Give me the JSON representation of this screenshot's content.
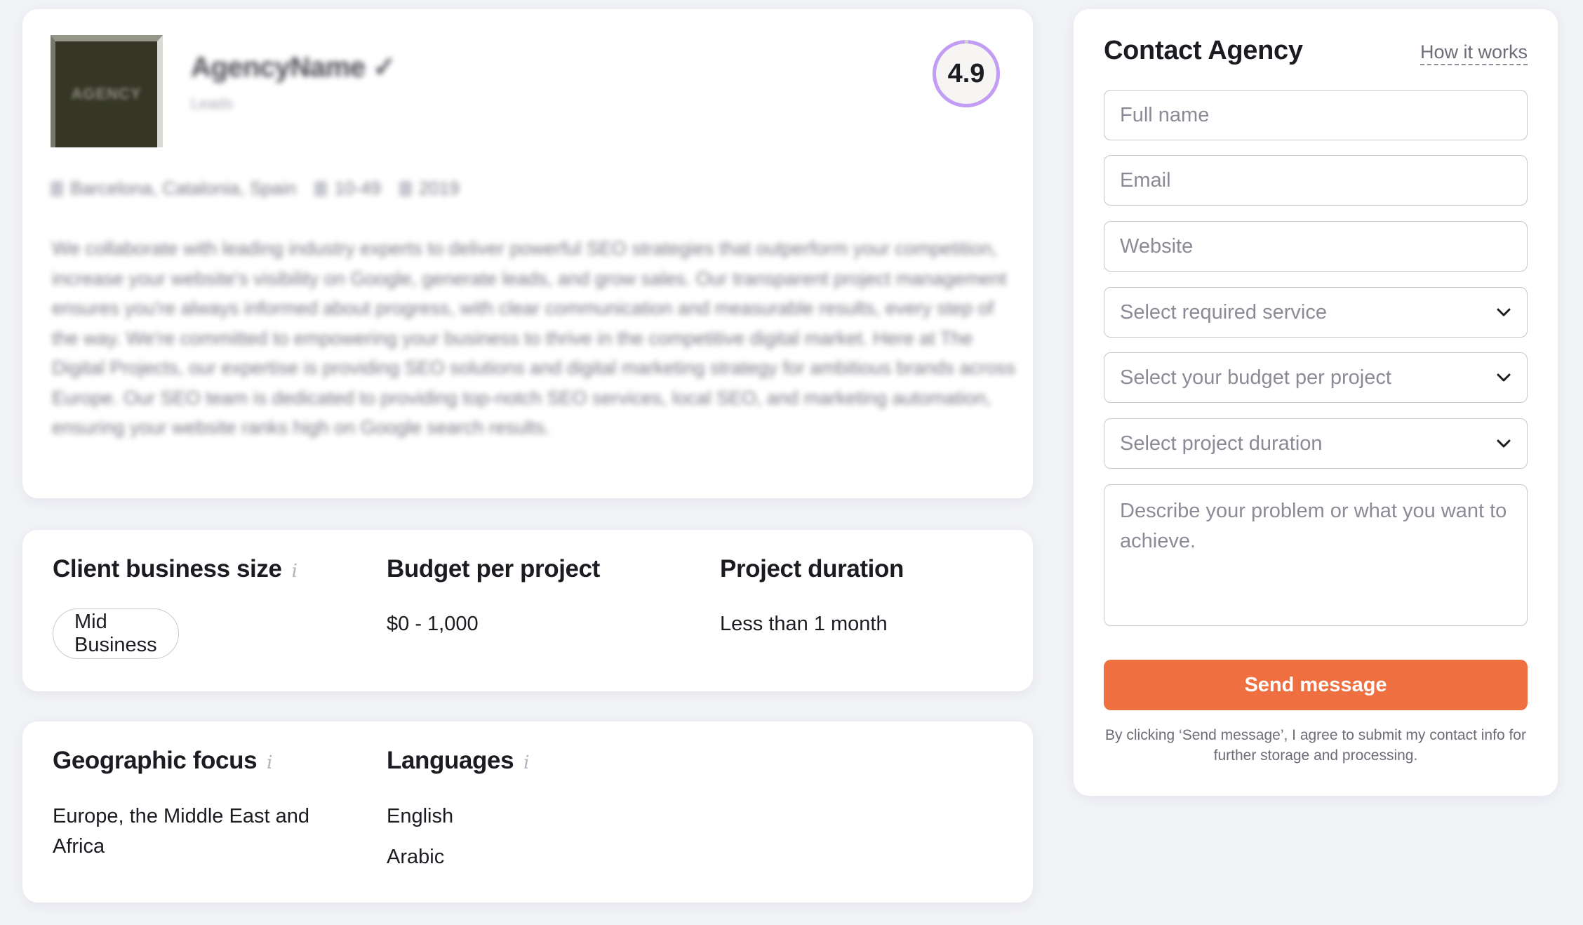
{
  "profile": {
    "logo_text": "AGENCY",
    "agency_name": "AgencyName ✓",
    "agency_subtitle": "Leads",
    "rating": "4.9",
    "rating_fraction": 0.98,
    "rating_color": "#c29cf5",
    "meta": {
      "location": "Barcelona, Catalonia, Spain",
      "team_size": "10-49",
      "founded": "2019"
    },
    "description": "We collaborate with leading industry experts to deliver powerful SEO strategies that outperform your competition, increase your website's visibility on Google, generate leads, and grow sales. Our transparent project management ensures you're always informed about progress, with clear communication and measurable results, every step of the way. We're committed to empowering your business to thrive in the competitive digital market. Here at The Digital Projects, our expertise is providing SEO solutions and digital marketing strategy for ambitious brands across Europe. Our SEO team is dedicated to providing top-notch SEO services, local SEO, and marketing automation, ensuring your website ranks high on Google search results."
  },
  "stats": {
    "client_size": {
      "title": "Client business size",
      "value": "Mid Business"
    },
    "budget": {
      "title": "Budget per project",
      "value": "$0 - 1,000"
    },
    "duration": {
      "title": "Project duration",
      "value": "Less than 1 month"
    }
  },
  "geo": {
    "focus": {
      "title": "Geographic focus",
      "value": "Europe, the Middle East and Africa"
    },
    "languages": {
      "title": "Languages",
      "values": [
        "English",
        "Arabic"
      ]
    }
  },
  "contact": {
    "title": "Contact Agency",
    "how_it_works": "How it works",
    "full_name_placeholder": "Full name",
    "email_placeholder": "Email",
    "website_placeholder": "Website",
    "service_select": "Select required service",
    "budget_select": "Select your budget per project",
    "duration_select": "Select project duration",
    "message_placeholder": "Describe your problem or what you want to achieve.",
    "send_label": "Send message",
    "send_color": "#ef6f40",
    "disclaimer": "By clicking ‘Send message’, I agree to submit my contact info for further storage and processing."
  }
}
